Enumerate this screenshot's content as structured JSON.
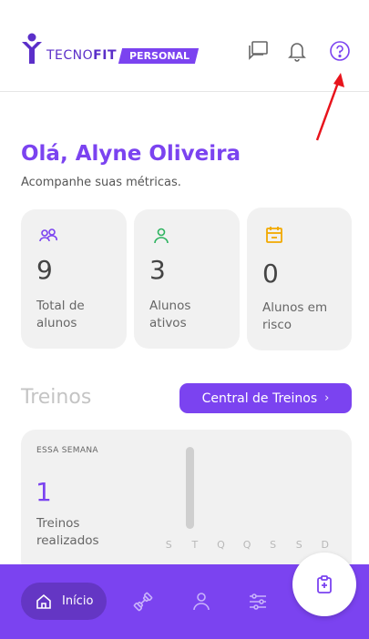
{
  "header": {
    "brand": {
      "word_light": "TECNO",
      "word_bold": "FIT",
      "badge": "PERSONAL"
    },
    "icons": [
      "chat-icon",
      "bell-icon",
      "help-icon"
    ]
  },
  "greeting": {
    "title": "Olá, Alyne Oliveira",
    "subtitle": "Acompanhe suas métricas."
  },
  "metrics": [
    {
      "icon": "users-icon",
      "value": "9",
      "label": "Total de alunos",
      "color": "#7b43f0"
    },
    {
      "icon": "user-icon",
      "value": "3",
      "label": "Alunos ativos",
      "color": "#2db35f"
    },
    {
      "icon": "calendar-icon",
      "value": "0",
      "label": "Alunos em risco",
      "color": "#f2a900"
    }
  ],
  "treinos": {
    "title": "Treinos",
    "central_button": "Central de Treinos",
    "week": {
      "label": "ESSA SEMANA",
      "value": "1",
      "description": "Treinos realizados",
      "days": [
        "S",
        "T",
        "Q",
        "Q",
        "S",
        "S",
        "D"
      ]
    }
  },
  "nav": {
    "home_label": "Início",
    "items": [
      "home-icon",
      "dumbbell-icon",
      "profile-icon",
      "settings-sliders-icon",
      "clipboard-icon"
    ]
  },
  "colors": {
    "primary": "#7b43f0",
    "card": "#f1f1f1",
    "annotation": "#e8141c"
  }
}
